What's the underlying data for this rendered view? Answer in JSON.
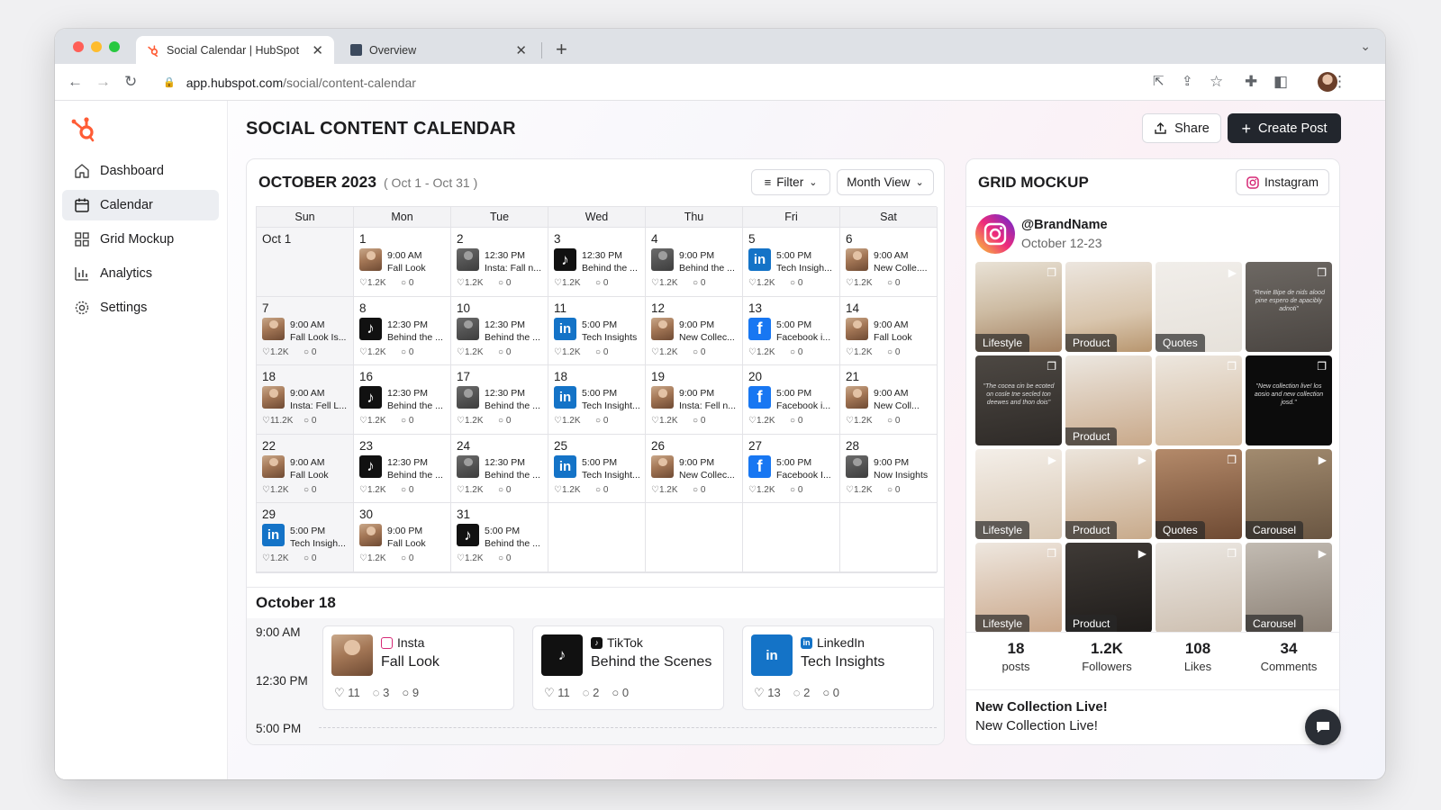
{
  "browser": {
    "tabs": [
      {
        "title": "Social Calendar | HubSpot",
        "icon": "hubspot-icon",
        "active": true
      },
      {
        "title": "Overview",
        "icon": "overview-icon",
        "active": false
      }
    ],
    "url_host": "app.hubspot.com",
    "url_path": "/social/content-calendar"
  },
  "sidebar": {
    "items": [
      {
        "label": "Dashboard",
        "icon": "home-icon"
      },
      {
        "label": "Calendar",
        "icon": "calendar-icon",
        "active": true
      },
      {
        "label": "Grid Mockup",
        "icon": "grid-icon"
      },
      {
        "label": "Analytics",
        "icon": "analytics-icon"
      },
      {
        "label": "Settings",
        "icon": "gear-icon"
      }
    ]
  },
  "header": {
    "title": "SOCIAL CONTENT CALENDAR",
    "share_label": "Share",
    "create_label": "Create Post"
  },
  "calendar": {
    "month_title": "OCTOBER 2023",
    "range": "( Oct 1 - Oct 31 )",
    "filter_label": "Filter",
    "view_label": "Month View",
    "weekdays": [
      "Sun",
      "Mon",
      "Tue",
      "Wed",
      "Thu",
      "Fri",
      "Sat"
    ],
    "cells": [
      {
        "day": "Oct 1"
      },
      {
        "day": "1",
        "time": "9:00 AM",
        "title": "Fall Look",
        "kind": "photo",
        "likes": "1.2K",
        "comments": "0"
      },
      {
        "day": "2",
        "time": "12:30 PM",
        "title": "Insta: Fall n...",
        "kind": "dark",
        "likes": "1.2K",
        "comments": "0"
      },
      {
        "day": "3",
        "time": "12:30 PM",
        "title": "Behind the ...",
        "kind": "tiktok",
        "likes": "1.2K",
        "comments": "0"
      },
      {
        "day": "4",
        "time": "9:00 PM",
        "title": "Behind the ...",
        "kind": "dark",
        "likes": "1.2K",
        "comments": "0"
      },
      {
        "day": "5",
        "time": "5:00 PM",
        "title": "Tech Insigh...",
        "kind": "linkedin",
        "likes": "1.2K",
        "comments": "0"
      },
      {
        "day": "6",
        "time": "9:00 AM",
        "title": "New Colle....",
        "kind": "photo",
        "likes": "1.2K",
        "comments": "0"
      },
      {
        "day": "7",
        "time": "9:00 AM",
        "title": "Fall Look Is...",
        "kind": "photo",
        "likes": "1.2K",
        "comments": "0"
      },
      {
        "day": "8",
        "time": "12:30 PM",
        "title": "Behind the ...",
        "kind": "tiktok",
        "likes": "1.2K",
        "comments": "0"
      },
      {
        "day": "10",
        "time": "12:30 PM",
        "title": "Behind the ...",
        "kind": "dark",
        "likes": "1.2K",
        "comments": "0"
      },
      {
        "day": "11",
        "time": "5:00 PM",
        "title": "Tech Insights",
        "kind": "linkedin",
        "likes": "1.2K",
        "comments": "0"
      },
      {
        "day": "12",
        "time": "9:00 PM",
        "title": "New Collec...",
        "kind": "photo",
        "likes": "1.2K",
        "comments": "0"
      },
      {
        "day": "13",
        "time": "5:00 PM",
        "title": "Facebook i...",
        "kind": "facebook",
        "likes": "1.2K",
        "comments": "0"
      },
      {
        "day": "14",
        "time": "9:00 AM",
        "title": "Fall Look",
        "kind": "photo",
        "likes": "1.2K",
        "comments": "0"
      },
      {
        "day": "18",
        "time": "9:00 AM",
        "title": "Insta: Fell L...",
        "kind": "photo",
        "likes": "11.2K",
        "comments": "0"
      },
      {
        "day": "16",
        "time": "12:30 PM",
        "title": "Behind the ...",
        "kind": "tiktok",
        "likes": "1.2K",
        "comments": "0"
      },
      {
        "day": "17",
        "time": "12:30 PM",
        "title": "Behind the ...",
        "kind": "dark",
        "likes": "1.2K",
        "comments": "0"
      },
      {
        "day": "18",
        "time": "5:00 PM",
        "title": "Tech Insight...",
        "kind": "linkedin",
        "likes": "1.2K",
        "comments": "0"
      },
      {
        "day": "19",
        "time": "9:00 PM",
        "title": "Insta: Fell n...",
        "kind": "photo",
        "likes": "1.2K",
        "comments": "0"
      },
      {
        "day": "20",
        "time": "5:00 PM",
        "title": "Facebook i...",
        "kind": "facebook",
        "likes": "1.2K",
        "comments": "0"
      },
      {
        "day": "21",
        "time": "9:00 AM",
        "title": "New Coll...",
        "kind": "photo",
        "likes": "1.2K",
        "comments": "0"
      },
      {
        "day": "22",
        "time": "9:00 AM",
        "title": "Fall Look",
        "kind": "photo",
        "likes": "1.2K",
        "comments": "0"
      },
      {
        "day": "23",
        "time": "12:30 PM",
        "title": "Behind the ...",
        "kind": "tiktok",
        "likes": "1.2K",
        "comments": "0"
      },
      {
        "day": "24",
        "time": "12:30 PM",
        "title": "Behind the ...",
        "kind": "dark",
        "likes": "1.2K",
        "comments": "0"
      },
      {
        "day": "25",
        "time": "5:00 PM",
        "title": "Tech Insight...",
        "kind": "linkedin",
        "likes": "1.2K",
        "comments": "0"
      },
      {
        "day": "26",
        "time": "9:00 PM",
        "title": "New Collec...",
        "kind": "photo",
        "likes": "1.2K",
        "comments": "0"
      },
      {
        "day": "27",
        "time": "5:00 PM",
        "title": "Facebook I...",
        "kind": "facebook",
        "likes": "1.2K",
        "comments": "0"
      },
      {
        "day": "28",
        "time": "9:00 PM",
        "title": "Now Insights",
        "kind": "dark",
        "likes": "1.2K",
        "comments": "0"
      },
      {
        "day": "29",
        "time": "5:00 PM",
        "title": "Tech Insigh...",
        "kind": "linkedin",
        "likes": "1.2K",
        "comments": "0"
      },
      {
        "day": "30",
        "time": "9:00 PM",
        "title": "Fall Look",
        "kind": "photo",
        "likes": "1.2K",
        "comments": "0"
      },
      {
        "day": "31",
        "time": "5:00 PM",
        "title": "Behind the ...",
        "kind": "tiktok",
        "likes": "1.2K",
        "comments": "0"
      },
      {},
      {},
      {},
      {}
    ]
  },
  "day_detail": {
    "title": "October 18",
    "times": [
      "9:00 AM",
      "12:30 PM",
      "5:00 PM"
    ],
    "posts": [
      {
        "platform": "Insta",
        "title": "Fall Look",
        "kind": "photo",
        "likes": "11",
        "reposts": "3",
        "comments": "9"
      },
      {
        "platform": "TikTok",
        "title": "Behind the Scenes",
        "kind": "tiktok",
        "likes": "11",
        "reposts": "2",
        "comments": "0"
      },
      {
        "platform": "LinkedIn",
        "title": "Tech Insights",
        "kind": "linkedin",
        "likes": "13",
        "reposts": "2",
        "comments": "0"
      }
    ]
  },
  "grid_mockup": {
    "title": "GRID MOCKUP",
    "platform_label": "Instagram",
    "handle": "@BrandName",
    "dates": "October 12-23",
    "tiles": [
      {
        "label": "Lifestyle",
        "icon": "copy-icon",
        "style": "t1"
      },
      {
        "label": "Product",
        "icon": "",
        "style": "t2"
      },
      {
        "label": "Quotes",
        "icon": "video-icon",
        "style": "t3"
      },
      {
        "label": "",
        "icon": "copy-icon",
        "style": "t4",
        "quote": "\"Revie Bipe de nids alood pine espero de apacibly adnoti\""
      },
      {
        "label": "",
        "icon": "copy-icon",
        "style": "t5",
        "quote": "\"The cocea cin be ecoted on cosle tne secled ton deewes and thon dois\""
      },
      {
        "label": "Product",
        "icon": "",
        "style": "t6"
      },
      {
        "label": "",
        "icon": "copy-icon",
        "style": "t7"
      },
      {
        "label": "",
        "icon": "copy-icon",
        "style": "t8",
        "quote": "\"New collection live! los aosio and new collection josd.\""
      },
      {
        "label": "Lifestyle",
        "icon": "video-icon",
        "style": "t9"
      },
      {
        "label": "Product",
        "icon": "video-icon",
        "style": "t10"
      },
      {
        "label": "Quotes",
        "icon": "copy-icon",
        "style": "t11"
      },
      {
        "label": "Carousel",
        "icon": "video-icon",
        "style": "t12"
      },
      {
        "label": "Lifestyle",
        "icon": "copy-icon",
        "style": "t13"
      },
      {
        "label": "Product",
        "icon": "video-icon",
        "style": "t14"
      },
      {
        "label": "",
        "icon": "copy-icon",
        "style": "t15"
      },
      {
        "label": "Carousel",
        "icon": "video-icon",
        "style": "t16"
      }
    ],
    "stats": [
      {
        "value": "18",
        "label": "posts"
      },
      {
        "value": "1.2K",
        "label": "Followers"
      },
      {
        "value": "108",
        "label": "Likes"
      },
      {
        "value": "34",
        "label": "Comments"
      }
    ],
    "caption_title": "New Collection Live!",
    "caption_body": "New Collection Live!"
  }
}
